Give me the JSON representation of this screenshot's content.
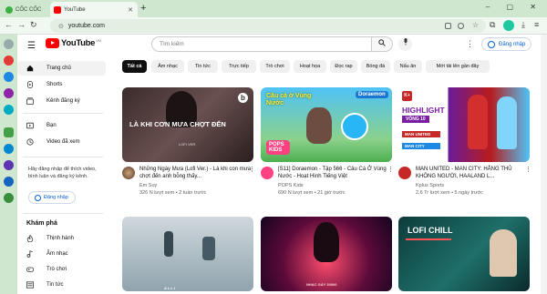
{
  "browser": {
    "tab1": {
      "label": "CỐC CỐC"
    },
    "tab2": {
      "label": "YouTube"
    },
    "new_tab": "+",
    "window_controls": "– ▢ ✕",
    "url": "youtube.com"
  },
  "youtube": {
    "logo_text": "YouTube",
    "logo_region": "VN",
    "search_placeholder": "Tìm kiếm",
    "search_icon": "search-icon",
    "sign_in": "Đăng nhập",
    "nav": [
      {
        "label": "Trang chủ",
        "icon": "home-icon",
        "active": true
      },
      {
        "label": "Shorts",
        "icon": "shorts-icon"
      },
      {
        "label": "Kênh đăng ký",
        "icon": "subscriptions-icon"
      },
      {
        "label": "Bạn",
        "icon": "you-icon"
      },
      {
        "label": "Video đã xem",
        "icon": "history-icon"
      }
    ],
    "signin_note": "Hãy đăng nhập để thích video, bình luận và đăng ký kênh.",
    "explore_title": "Khám phá",
    "explore": [
      {
        "label": "Thịnh hành",
        "icon": "trending-icon"
      },
      {
        "label": "Âm nhạc",
        "icon": "music-icon"
      },
      {
        "label": "Trò chơi",
        "icon": "gaming-icon"
      },
      {
        "label": "Tin tức",
        "icon": "news-icon"
      }
    ],
    "chips": [
      "Tất cả",
      "Âm nhạc",
      "Tin tức",
      "Trực tiếp",
      "Trò chơi",
      "Hoạt họa",
      "Đọc rap",
      "Bóng đá",
      "Nấu ăn",
      "Mới tải lên gần đây"
    ],
    "videos": [
      {
        "title": "Những Ngày Mưa (Lofi Ver.) - Là khi con mưa chợt đến anh bỗng thấy...",
        "channel": "Em Suy",
        "meta": "326 N lượt xem • 2 tuần trước",
        "thumb_text": "LÀ KHI CƠN MƯA CHỢT ĐẾN",
        "thumb_sub": "LOFI VER."
      },
      {
        "title": "[S11] Doraemon - Tập 566 - Câu Cá Ở Vùng Nước - Hoạt Hình Tiếng Việt",
        "channel": "POPS Kids",
        "meta": "690 N lượt xem • 21 giờ trước",
        "thumb_text": "Câu cá ở Vùng Nước",
        "thumb_badge": "Doraemon",
        "thumb_logo": "POPS KIDS"
      },
      {
        "title": "MAN UNITED - MAN CITY: HẰNG THỦ KHÔNG NGƯỜI, HAALAND L...",
        "channel": "Kplus Sports",
        "meta": "2,6 Tr lượt xem • 5 ngày trước",
        "thumb_text": "HIGHLIGHT",
        "thumb_round": "VÒNG 10",
        "team1": "MAN UNITED",
        "team2": "MAN CITY"
      },
      {
        "thumb_text": "",
        "thumb_brand": "ALLI"
      },
      {
        "thumb_text": "",
        "thumb_sub": "NHẠC GÁY 30000"
      },
      {
        "thumb_text": "LOFI CHILL"
      }
    ]
  }
}
